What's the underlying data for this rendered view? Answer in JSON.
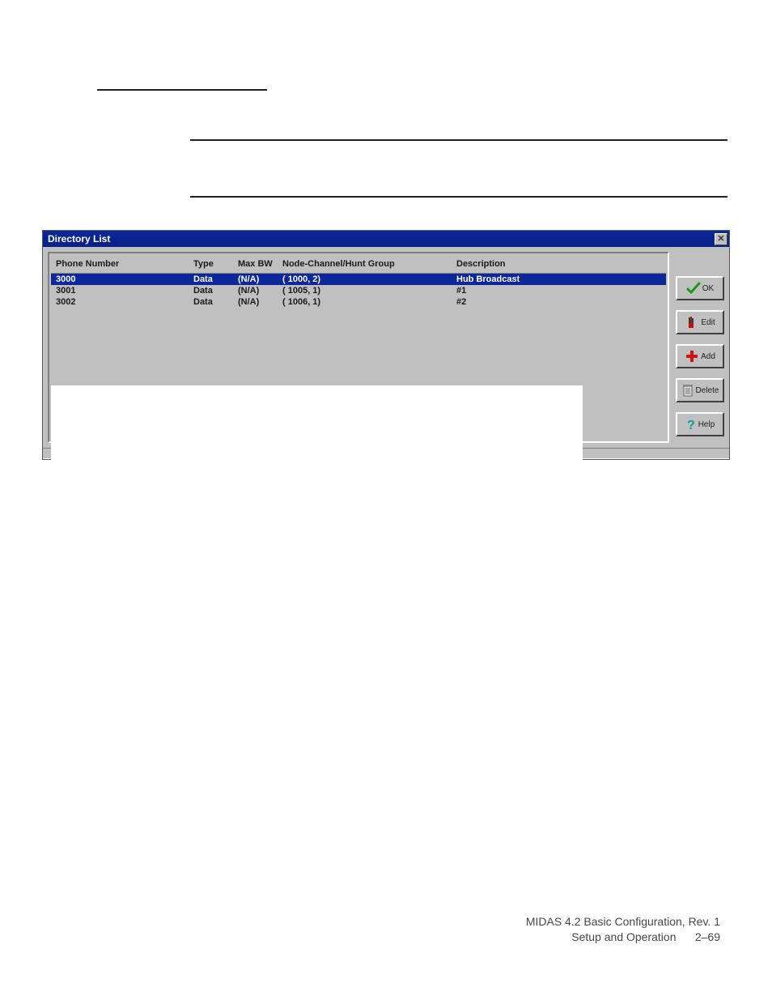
{
  "window": {
    "title": "Directory List",
    "headers": {
      "phone": "Phone Number",
      "type": "Type",
      "maxbw": "Max BW",
      "node": "Node-Channel/Hunt Group",
      "desc": "Description"
    },
    "rows": [
      {
        "phone": "3000",
        "type": "Data",
        "maxbw": "(N/A)",
        "node": "( 1000, 2)",
        "desc": "Hub Broadcast",
        "selected": true
      },
      {
        "phone": "3001",
        "type": "Data",
        "maxbw": "(N/A)",
        "node": "( 1005, 1)",
        "desc": "#1",
        "selected": false
      },
      {
        "phone": "3002",
        "type": "Data",
        "maxbw": "(N/A)",
        "node": "( 1006, 1)",
        "desc": "#2",
        "selected": false
      }
    ],
    "buttons": {
      "ok": "OK",
      "edit": "Edit",
      "add": "Add",
      "delete": "Delete",
      "help": "Help"
    }
  },
  "footer": {
    "line1": "MIDAS 4.2 Basic Configuration, Rev. 1",
    "line2a": "Setup and Operation",
    "line2b": "2–69"
  }
}
